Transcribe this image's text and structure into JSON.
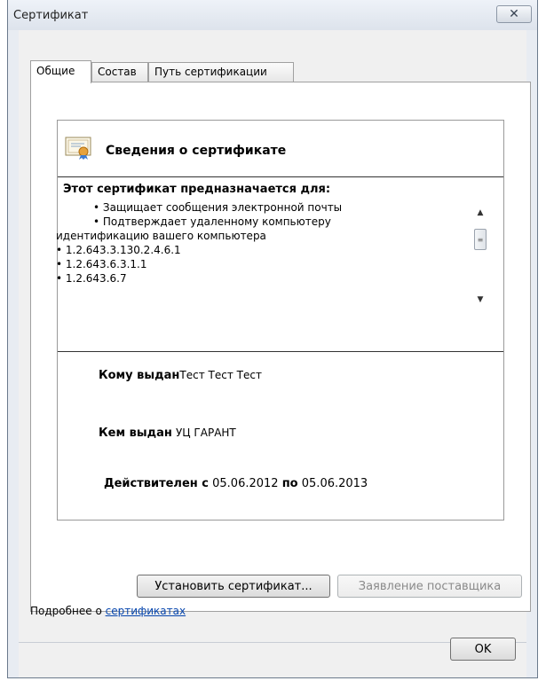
{
  "window": {
    "title": "Сертификат",
    "close_symbol": "✕"
  },
  "tabs": [
    {
      "label": "Общие",
      "active": true
    },
    {
      "label": "Состав",
      "active": false
    },
    {
      "label": "Путь сертификации",
      "active": false
    }
  ],
  "cert": {
    "heading": "Сведения о сертификате",
    "purpose_heading": "Этот сертификат предназначается для:",
    "purposes": [
      "•  Защищает сообщения электронной почты",
      "•  Подтверждает удаленному компьютеру",
      "идентификацию вашего компьютера",
      "• 1.2.643.3.130.2.4.6.1",
      "• 1.2.643.6.3.1.1",
      "• 1.2.643.6.7"
    ],
    "issued_to_label": "Кому выдан",
    "issued_to_value": "Тест Тест Тест",
    "issued_by_label": "Кем выдан",
    "issued_by_value": "УЦ ГАРАНТ",
    "valid_label": "Действителен с",
    "valid_from": "05.06.2012",
    "valid_to_label": "по",
    "valid_to": "05.06.2013"
  },
  "buttons": {
    "install": "Установить сертификат...",
    "statement": "Заявление поставщика",
    "ok": "OK"
  },
  "more_info": {
    "prefix": "Подробнее о ",
    "link": "сертификатах"
  },
  "colors": {
    "link": "#0645ad",
    "panel_bg": "#ffffff",
    "frame_bg": "#f0f0f0"
  },
  "icons": {
    "cert": "certificate-icon",
    "close": "close-icon",
    "up": "scroll-up-icon",
    "down": "scroll-down-icon"
  }
}
